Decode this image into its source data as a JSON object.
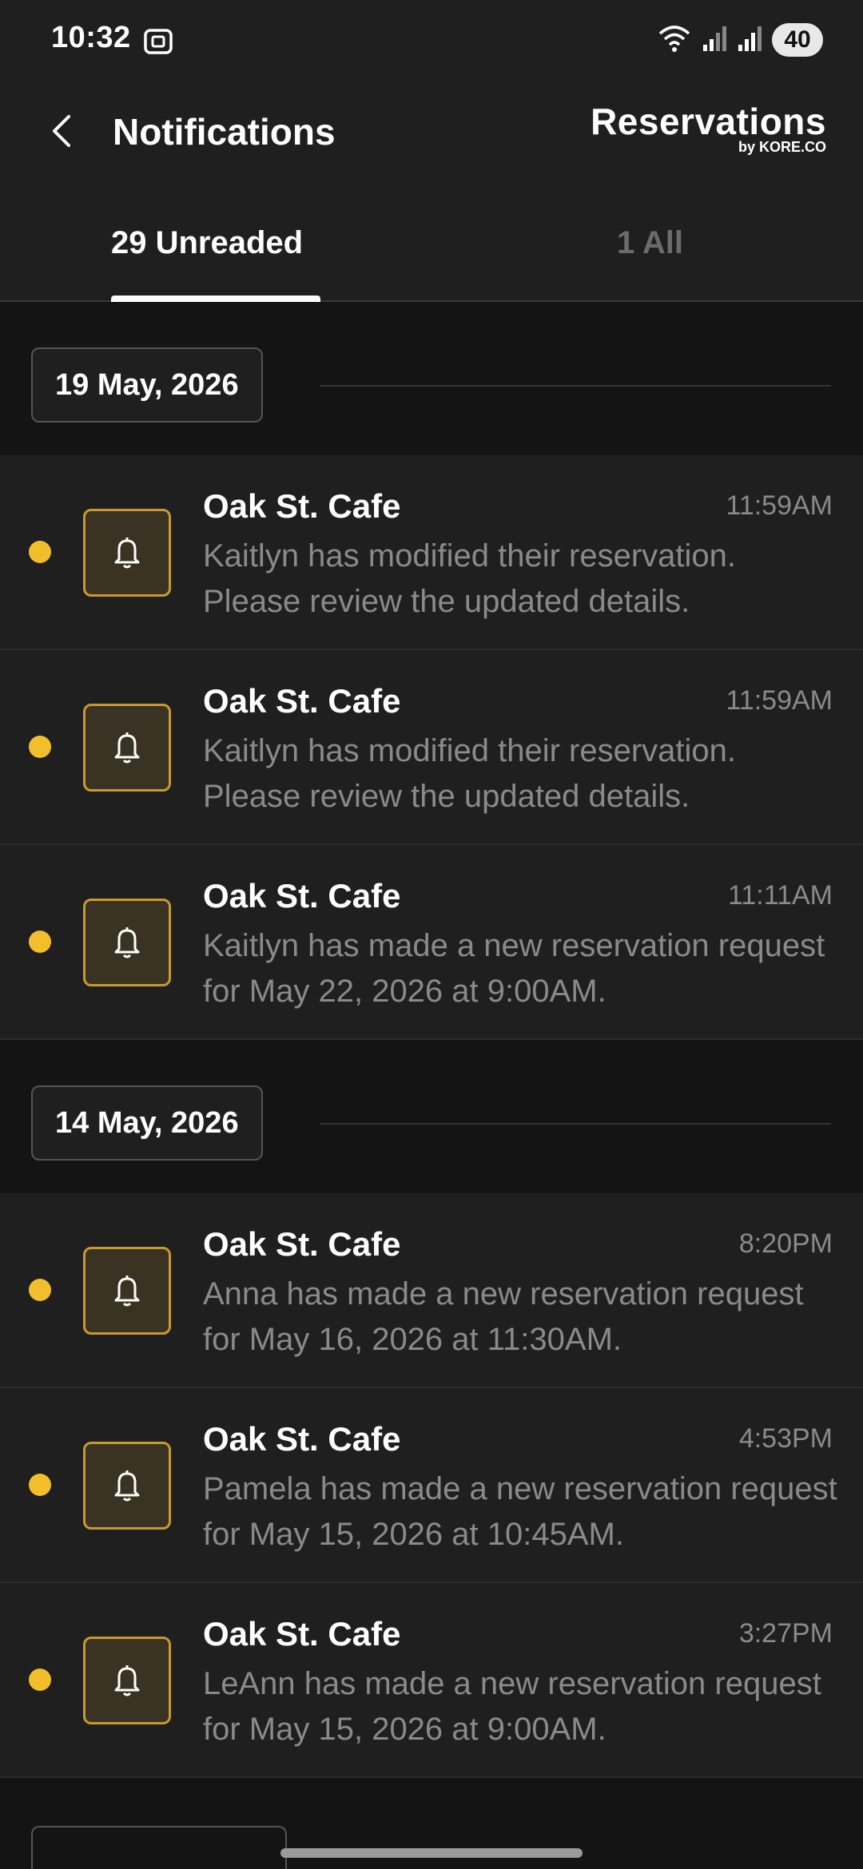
{
  "status": {
    "time": "10:32",
    "battery": "40"
  },
  "header": {
    "title": "Notifications",
    "logo_main": "Reservations",
    "logo_sub": "by KORE.CO"
  },
  "tabs": [
    {
      "label": "29 Unreaded",
      "active": true
    },
    {
      "label": "1 All",
      "active": false
    }
  ],
  "groups": [
    {
      "date": "19 May, 2026",
      "items": [
        {
          "title": "Oak St. Cafe",
          "time": "11:59AM",
          "body": "Kaitlyn has modified their reservation. Please review the updated details."
        },
        {
          "title": "Oak St. Cafe",
          "time": "11:59AM",
          "body": "Kaitlyn has modified their reservation. Please review the updated details."
        },
        {
          "title": "Oak St. Cafe",
          "time": "11:11AM",
          "body": "Kaitlyn has made a new reservation request for May 22, 2026 at 9:00AM."
        }
      ]
    },
    {
      "date": "14 May, 2026",
      "items": [
        {
          "title": "Oak St. Cafe",
          "time": "8:20PM",
          "body": "Anna has made a new reservation request for May 16, 2026 at 11:30AM."
        },
        {
          "title": "Oak St. Cafe",
          "time": "4:53PM",
          "body": "Pamela has made a new reservation request for May 15, 2026 at 10:45AM."
        },
        {
          "title": "Oak St. Cafe",
          "time": "3:27PM",
          "body": "LeAnn has made a new reservation request for May 15, 2026 at 9:00AM."
        }
      ]
    }
  ],
  "colors": {
    "unread_dot": "#f2bf2b",
    "bell_border": "#c89a2e",
    "background": "#141414",
    "card": "#1f1f1f"
  }
}
